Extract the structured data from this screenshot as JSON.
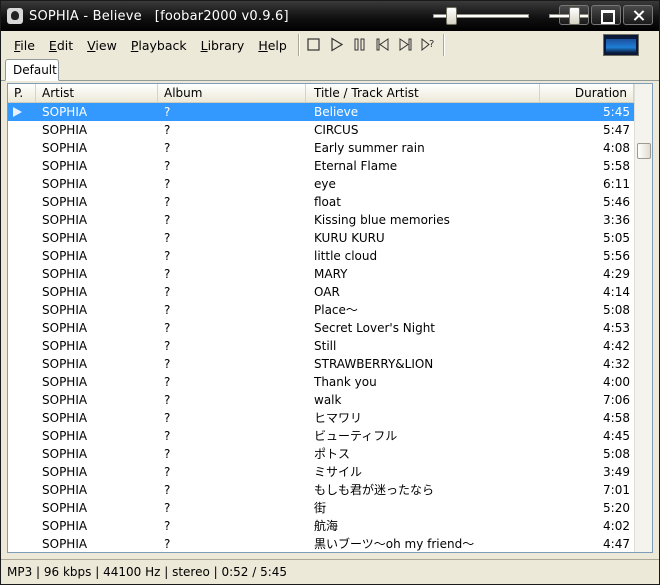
{
  "window": {
    "title": "SOPHIA - Believe   [foobar2000 v0.9.6]"
  },
  "menu": [
    {
      "acc": "F",
      "rest": "ile"
    },
    {
      "acc": "E",
      "rest": "dit"
    },
    {
      "acc": "V",
      "rest": "iew"
    },
    {
      "acc": "P",
      "rest": "layback"
    },
    {
      "acc": "L",
      "rest": "ibrary"
    },
    {
      "acc": "H",
      "rest": "elp"
    }
  ],
  "controls": [
    "stop-icon",
    "play-icon",
    "pause-icon",
    "previous-icon",
    "next-icon",
    "random-icon"
  ],
  "seek": {
    "position_fraction": 0.15
  },
  "volume": {
    "level_fraction": 0.7
  },
  "tabs": [
    {
      "label": "Default"
    }
  ],
  "playlist": {
    "columns": {
      "playing": "P.",
      "artist": "Artist",
      "album": "Album",
      "title": "Title / Track Artist",
      "duration": "Duration"
    },
    "selected_index": 0,
    "rows": [
      {
        "artist": "SOPHIA",
        "album": "?",
        "title": "Believe",
        "duration": "5:45"
      },
      {
        "artist": "SOPHIA",
        "album": "?",
        "title": "CIRCUS",
        "duration": "5:47"
      },
      {
        "artist": "SOPHIA",
        "album": "?",
        "title": "Early summer rain",
        "duration": "4:08"
      },
      {
        "artist": "SOPHIA",
        "album": "?",
        "title": "Eternal Flame",
        "duration": "5:58"
      },
      {
        "artist": "SOPHIA",
        "album": "?",
        "title": "eye",
        "duration": "6:11"
      },
      {
        "artist": "SOPHIA",
        "album": "?",
        "title": "float",
        "duration": "5:46"
      },
      {
        "artist": "SOPHIA",
        "album": "?",
        "title": "Kissing blue memories",
        "duration": "3:36"
      },
      {
        "artist": "SOPHIA",
        "album": "?",
        "title": "KURU KURU",
        "duration": "5:05"
      },
      {
        "artist": "SOPHIA",
        "album": "?",
        "title": "little cloud",
        "duration": "5:56"
      },
      {
        "artist": "SOPHIA",
        "album": "?",
        "title": "MARY",
        "duration": "4:29"
      },
      {
        "artist": "SOPHIA",
        "album": "?",
        "title": "OAR",
        "duration": "4:14"
      },
      {
        "artist": "SOPHIA",
        "album": "?",
        "title": "Place〜",
        "duration": "5:08"
      },
      {
        "artist": "SOPHIA",
        "album": "?",
        "title": "Secret Lover's Night",
        "duration": "4:53"
      },
      {
        "artist": "SOPHIA",
        "album": "?",
        "title": "Still",
        "duration": "4:42"
      },
      {
        "artist": "SOPHIA",
        "album": "?",
        "title": "STRAWBERRY&LION",
        "duration": "4:32"
      },
      {
        "artist": "SOPHIA",
        "album": "?",
        "title": "Thank you",
        "duration": "4:00"
      },
      {
        "artist": "SOPHIA",
        "album": "?",
        "title": "walk",
        "duration": "7:06"
      },
      {
        "artist": "SOPHIA",
        "album": "?",
        "title": "ヒマワリ",
        "duration": "4:58"
      },
      {
        "artist": "SOPHIA",
        "album": "?",
        "title": "ビューティフル",
        "duration": "4:45"
      },
      {
        "artist": "SOPHIA",
        "album": "?",
        "title": "ポトス",
        "duration": "5:08"
      },
      {
        "artist": "SOPHIA",
        "album": "?",
        "title": "ミサイル",
        "duration": "3:49"
      },
      {
        "artist": "SOPHIA",
        "album": "?",
        "title": "もしも君が迷ったなら",
        "duration": "7:01"
      },
      {
        "artist": "SOPHIA",
        "album": "?",
        "title": "街",
        "duration": "5:20"
      },
      {
        "artist": "SOPHIA",
        "album": "?",
        "title": "航海",
        "duration": "4:02"
      },
      {
        "artist": "SOPHIA",
        "album": "?",
        "title": "黒いブーツ〜oh my friend〜",
        "duration": "4:47"
      }
    ]
  },
  "status": {
    "text": "MP3 | 96 kbps | 44100 Hz | stereo | 0:52 / 5:45"
  },
  "colors": {
    "selection": "#3399ff",
    "titlebar": "#000000",
    "face": "#ece9d8"
  }
}
